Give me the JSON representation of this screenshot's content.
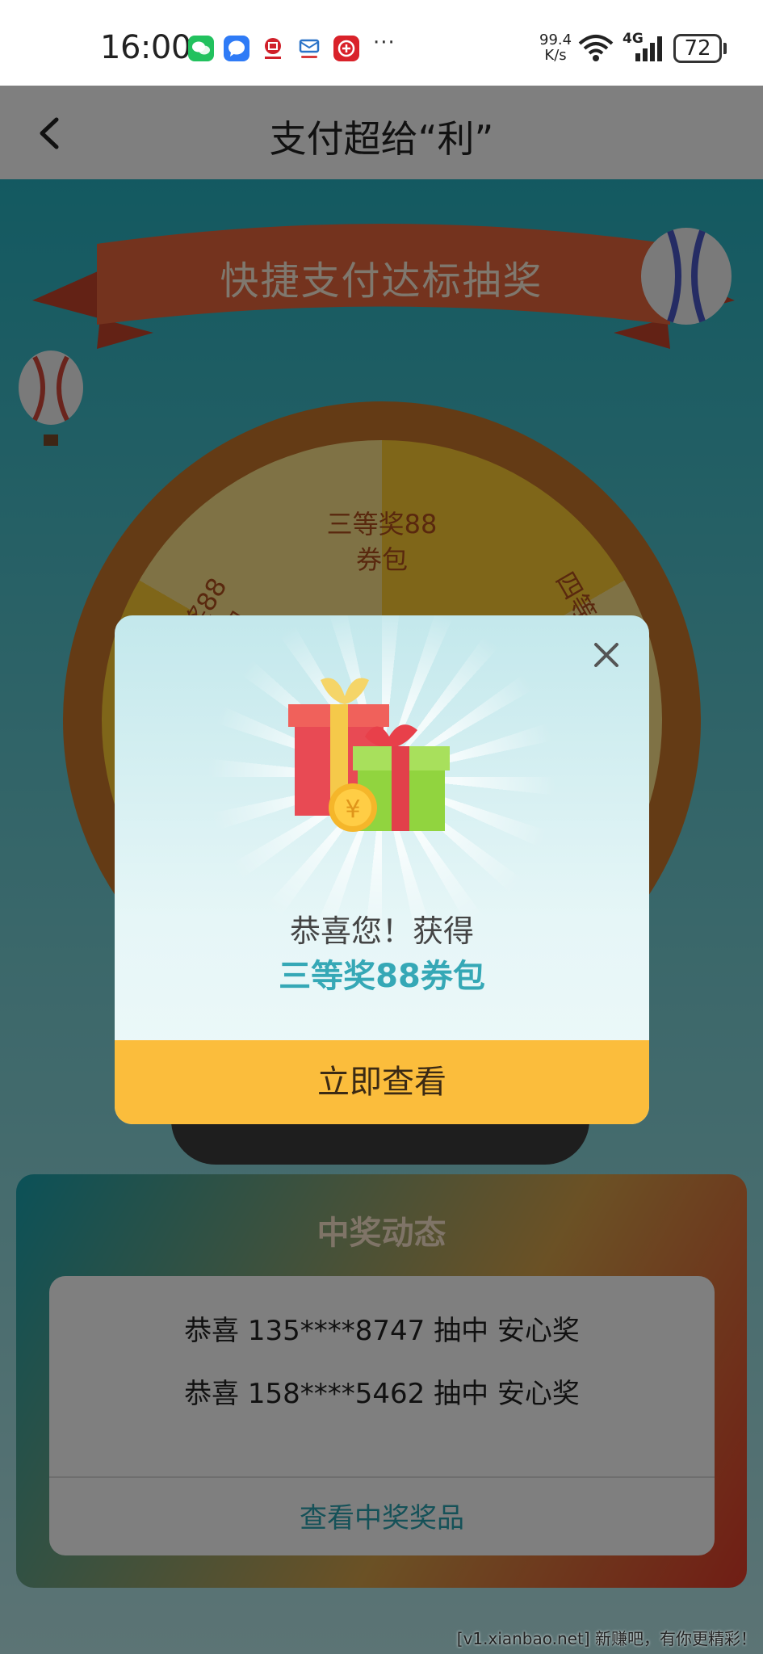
{
  "status_bar": {
    "time": "16:00",
    "net_speed_value": "99.4",
    "net_speed_unit": "K/s",
    "network_type": "4G",
    "battery": "72",
    "more_indicator": "···",
    "app_icons": [
      "wechat-icon",
      "message-icon",
      "bank-app-icon",
      "mail-app-icon",
      "unionpay-app-icon"
    ]
  },
  "header": {
    "title": "支付超给“利”",
    "back_icon": "chevron-left-icon"
  },
  "activity": {
    "banner": "快捷支付达标抽奖",
    "wheel_segments": [
      "三等奖88\n券包",
      "奖88\n包",
      "四等"
    ]
  },
  "winners": {
    "title": "中奖动态",
    "rows": [
      "恭喜 135****8747 抽中 安心奖",
      "恭喜 158****5462 抽中 安心奖"
    ],
    "link": "查看中奖奖品"
  },
  "modal": {
    "congrats": "恭喜您！获得",
    "prize": "三等奖88券包",
    "button": "立即查看",
    "close_icon": "close-icon"
  },
  "watermark": "[v1.xianbao.net] 新赚吧，有你更精彩！",
  "colors": {
    "accent_teal": "#35a8b6",
    "button_yellow": "#fbbd3c",
    "overlay": "rgba(0,0,0,0.5)"
  }
}
